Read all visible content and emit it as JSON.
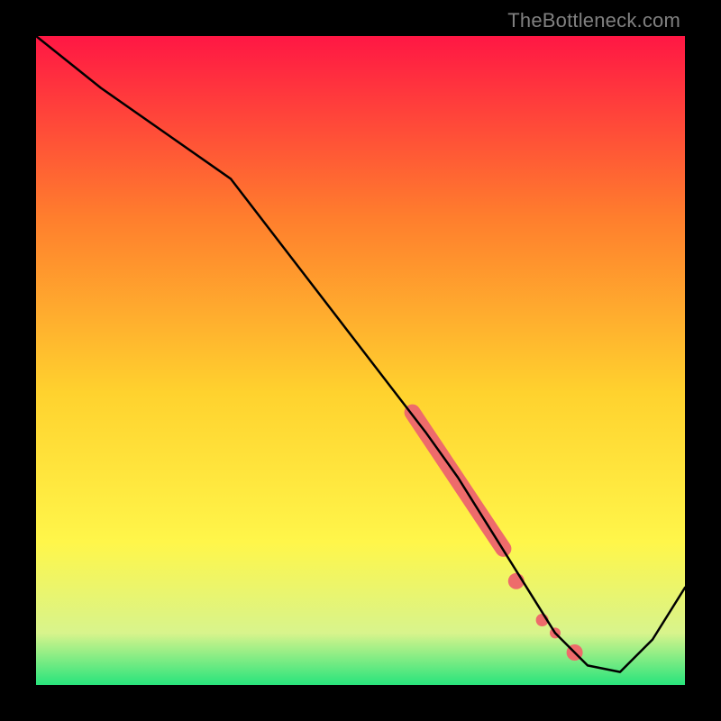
{
  "watermark": "TheBottleneck.com",
  "chart_data": {
    "type": "line",
    "title": "",
    "xlabel": "",
    "ylabel": "",
    "xlim": [
      0,
      100
    ],
    "ylim": [
      0,
      100
    ],
    "grid": false,
    "background_gradient": {
      "top_color": "#ff1744",
      "mid_upper_color": "#ff7e2d",
      "mid_color": "#ffd22e",
      "mid_lower_color": "#fff64a",
      "near_bottom_color": "#d8f48c",
      "bottom_color": "#28e47c"
    },
    "series": [
      {
        "name": "bottleneck-curve",
        "color": "#000000",
        "x": [
          0,
          10,
          20,
          30,
          40,
          50,
          60,
          65,
          70,
          75,
          80,
          85,
          90,
          95,
          100
        ],
        "values": [
          100,
          92,
          85,
          78,
          65,
          52,
          39,
          32,
          24,
          16,
          8,
          3,
          2,
          7,
          15
        ]
      }
    ],
    "highlight_segments": [
      {
        "name": "thick-segment",
        "color": "#ee6b6b",
        "width": 18,
        "x": [
          58,
          60,
          62,
          64,
          66,
          68,
          70,
          72
        ],
        "values": [
          42,
          39,
          36,
          33,
          30,
          27,
          24,
          21
        ]
      }
    ],
    "highlight_dots": [
      {
        "x": 74,
        "y": 16,
        "r": 9,
        "color": "#ee6b6b"
      },
      {
        "x": 78,
        "y": 10,
        "r": 7,
        "color": "#ee6b6b"
      },
      {
        "x": 80,
        "y": 8,
        "r": 6,
        "color": "#ee6b6b"
      },
      {
        "x": 83,
        "y": 5,
        "r": 9,
        "color": "#ee6b6b"
      }
    ]
  }
}
